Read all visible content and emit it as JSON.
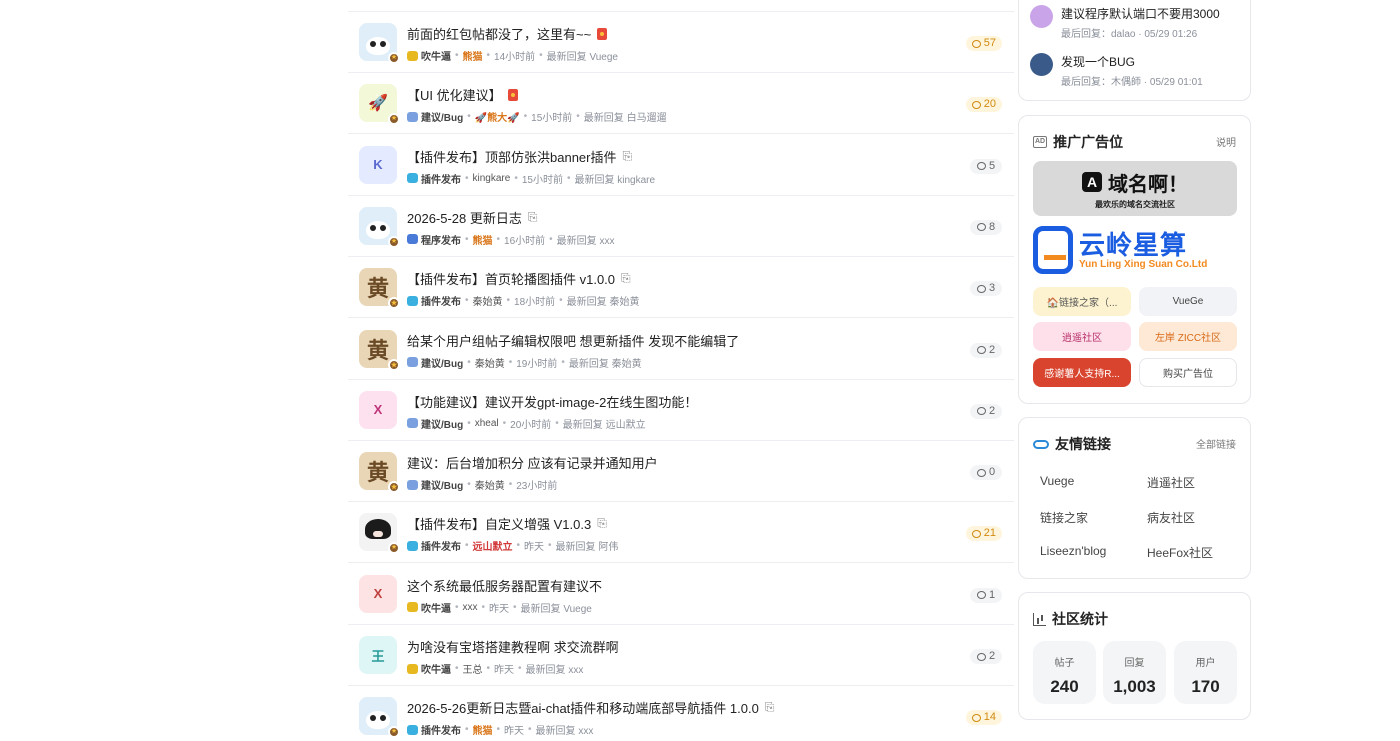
{
  "topics": [
    {
      "title": "前面的红包帖都没了，这里有~~",
      "category": "吹牛逼",
      "cat_icon": "chat-icon",
      "author": "熊猫",
      "author_style": "hl",
      "time": "14小时前",
      "last_reply": "最新回复 Vuege",
      "count": "57",
      "hot": true,
      "extra": "redpack",
      "avatar": "panda"
    },
    {
      "title": "【UI 优化建议】",
      "category": "建议/Bug",
      "cat_icon": "bug-icon",
      "author": "🚀熊大🚀",
      "author_style": "hl",
      "time": "15小时前",
      "last_reply": "最新回复 白马遛遛",
      "count": "20",
      "hot": true,
      "extra": "redpack",
      "avatar": "rocket"
    },
    {
      "title": "【插件发布】顶部仿张洪banner插件",
      "category": "插件发布",
      "cat_icon": "puzzle-icon",
      "author": "kingkare",
      "author_style": "",
      "time": "15小时前",
      "last_reply": "最新回复 kingkare",
      "count": "5",
      "hot": false,
      "extra": "clip",
      "avatar": "K"
    },
    {
      "title": "2026-5-28 更新日志",
      "category": "程序发布",
      "cat_icon": "release-icon",
      "author": "熊猫",
      "author_style": "hl",
      "time": "16小时前",
      "last_reply": "最新回复 xxx",
      "count": "8",
      "hot": false,
      "extra": "clip",
      "avatar": "panda"
    },
    {
      "title": "【插件发布】首页轮播图插件 v1.0.0",
      "category": "插件发布",
      "cat_icon": "puzzle-icon",
      "author": "秦始黄",
      "author_style": "",
      "time": "18小时前",
      "last_reply": "最新回复 秦始黄",
      "count": "3",
      "hot": false,
      "extra": "clip",
      "avatar": "glyph"
    },
    {
      "title": "给某个用户组帖子编辑权限吧 想更新插件 发现不能编辑了",
      "category": "建议/Bug",
      "cat_icon": "bug-icon",
      "author": "秦始黄",
      "author_style": "",
      "time": "19小时前",
      "last_reply": "最新回复 秦始黄",
      "count": "2",
      "hot": false,
      "extra": "",
      "avatar": "glyph"
    },
    {
      "title": "【功能建议】建议开发gpt-image-2在线生图功能！",
      "category": "建议/Bug",
      "cat_icon": "bug-icon",
      "author": "xheal",
      "author_style": "",
      "time": "20小时前",
      "last_reply": "最新回复 远山默立",
      "count": "2",
      "hot": false,
      "extra": "",
      "avatar": "X"
    },
    {
      "title": "建议：后台增加积分 应该有记录并通知用户",
      "category": "建议/Bug",
      "cat_icon": "bug-icon",
      "author": "秦始黄",
      "author_style": "",
      "time": "23小时前",
      "last_reply": "",
      "count": "0",
      "hot": false,
      "extra": "",
      "avatar": "glyph"
    },
    {
      "title": "【插件发布】自定义增强 V1.0.3",
      "category": "插件发布",
      "cat_icon": "puzzle-icon",
      "author": "远山默立",
      "author_style": "red",
      "time": "昨天",
      "last_reply": "最新回复 阿伟",
      "count": "21",
      "hot": true,
      "extra": "clip",
      "avatar": "anime"
    },
    {
      "title": "这个系统最低服务器配置有建议不",
      "category": "吹牛逼",
      "cat_icon": "chat-icon",
      "author": "xxx",
      "author_style": "",
      "time": "昨天",
      "last_reply": "最新回复 Vuege",
      "count": "1",
      "hot": false,
      "extra": "",
      "avatar": "X2"
    },
    {
      "title": "为啥没有宝塔搭建教程啊 求交流群啊",
      "category": "吹牛逼",
      "cat_icon": "chat-icon",
      "author": "王总",
      "author_style": "",
      "time": "昨天",
      "last_reply": "最新回复 xxx",
      "count": "2",
      "hot": false,
      "extra": "",
      "avatar": "王"
    },
    {
      "title": "2026-5-26更新日志暨ai-chat插件和移动端底部导航插件 1.0.0",
      "category": "插件发布",
      "cat_icon": "puzzle-icon",
      "author": "熊猫",
      "author_style": "hl",
      "time": "昨天",
      "last_reply": "最新回复 xxx",
      "count": "14",
      "hot": true,
      "extra": "clip",
      "avatar": "panda"
    }
  ],
  "recent": [
    {
      "title": "建议程序默认端口不要用3000",
      "sub": "最后回复：dalao · 05/29 01:26",
      "avatar_color": "#c9a4e8"
    },
    {
      "title": "发现一个BUG",
      "sub": "最后回复：木偶師 · 05/29 01:01",
      "avatar_color": "#3a5a8a"
    }
  ],
  "ads": {
    "title": "推广广告位",
    "link": "说明",
    "icon_text": "AD",
    "banner1": {
      "logo": "A",
      "main": "域名啊！",
      "sub": "最欢乐的域名交流社区"
    },
    "banner2": {
      "main": "云岭星算",
      "sub": "Yun Ling Xing Suan Co.Ltd"
    },
    "buttons": [
      {
        "label": "🏠链接之家（...",
        "bg": "#fdf3d0",
        "fg": "#555"
      },
      {
        "label": "VueGe",
        "bg": "#f1f3f6",
        "fg": "#444"
      },
      {
        "label": "逍遥社区",
        "bg": "#fde0ea",
        "fg": "#b8306a"
      },
      {
        "label": "左岸 ZICC社区",
        "bg": "#fde9d6",
        "fg": "#d86a18"
      },
      {
        "label": "感谢薯人支持R...",
        "bg": "#d9442e",
        "fg": "#ffffff"
      },
      {
        "label": "购买广告位",
        "bg": "#ffffff",
        "fg": "#444"
      }
    ]
  },
  "links": {
    "title": "友情链接",
    "link": "全部链接",
    "items": [
      "Vuege",
      "逍遥社区",
      "链接之家",
      "病友社区",
      "Liseezn'blog",
      "HeeFox社区"
    ]
  },
  "stats": {
    "title": "社区统计",
    "items": [
      {
        "label": "帖子",
        "value": "240"
      },
      {
        "label": "回复",
        "value": "1,003"
      },
      {
        "label": "用户",
        "value": "170"
      }
    ]
  },
  "colors": {
    "accent": "#d9761a",
    "hot_bg": "#fff5dc",
    "link_blue": "#2a8ad8"
  }
}
